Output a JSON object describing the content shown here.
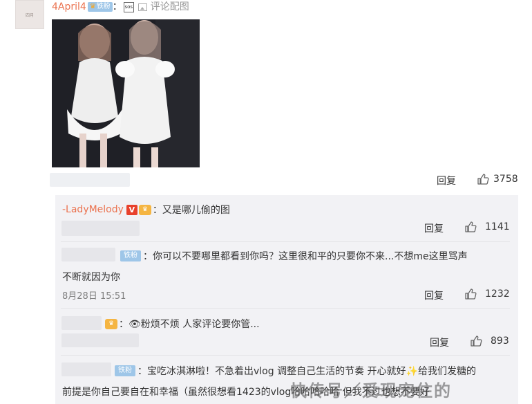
{
  "comment": {
    "username": "4April4",
    "fan_badge": "铁粉",
    "sos_text": "sos",
    "separator": "：",
    "pic_link": "评论配图",
    "avatar_text": "四月",
    "reply_label": "回复",
    "like_count": "3758"
  },
  "replies": [
    {
      "username": "-LadyMelody",
      "vip_badge": "V",
      "text": "：又是哪儿偷的图",
      "reply_label": "回复",
      "like_count": "1141"
    },
    {
      "fan_badge": "铁粉",
      "text_line1": "：你可以不要哪里都看到你吗？这里很和平的只要你不来...不想me这里骂声",
      "text_line2": "不断就因为你",
      "timestamp": "8月28日 15:51",
      "reply_label": "回复",
      "like_count": "1232"
    },
    {
      "text": "：👁粉烦不烦 人家评论要你管...",
      "reply_label": "回复",
      "like_count": "893"
    },
    {
      "fan_badge": "铁粉",
      "text_line1": "：宝吃冰淇淋啦！不急着出vlog 调整自己生活的节奏 开心就好✨给我们发糖的",
      "text_line2": "前提是你自己要自在和幸福（虽然很想看1423的vlog哈哈哈哈哈 但我不过也想不要好"
    }
  ],
  "watermark": "快传号／爱现宠住的",
  "colors": {
    "username": "#eb7350",
    "fan_badge": "#9ec6e8",
    "reply_box": "#f2f2f5",
    "vip_red": "#e8412c"
  },
  "icons": [
    "sos-icon",
    "picture-icon",
    "thumbs-up-icon",
    "vip-icon",
    "crown-icon"
  ]
}
